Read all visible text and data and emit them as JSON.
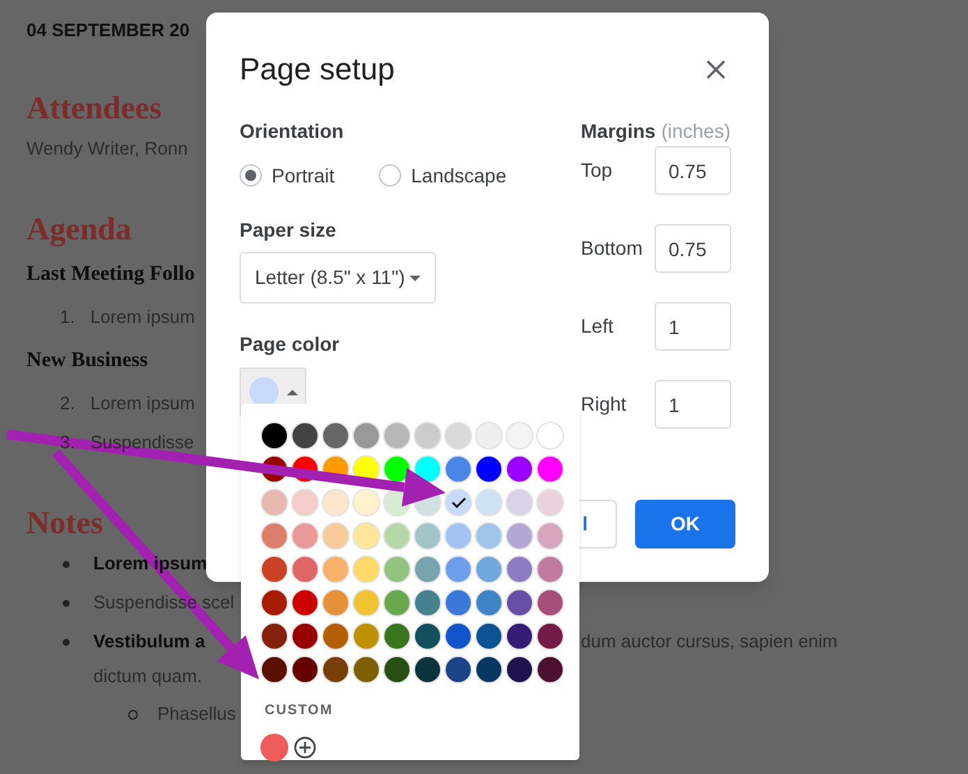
{
  "document": {
    "blocks": [
      {
        "kind": "date",
        "text": "04 SEPTEMBER 20"
      },
      {
        "kind": "heading",
        "text": "Attendees"
      },
      {
        "kind": "para",
        "text": "Wendy Writer, Ronn"
      },
      {
        "kind": "heading",
        "text": "Agenda"
      },
      {
        "kind": "subheading",
        "text": "Last Meeting Follo"
      },
      {
        "kind": "numbered",
        "number": "1.",
        "text": "Lorem ipsum"
      },
      {
        "kind": "subheading",
        "text": "New Business"
      },
      {
        "kind": "numbered",
        "number": "2.",
        "text": "Lorem ipsum"
      },
      {
        "kind": "numbered",
        "number": "3.",
        "text": "Suspendisse"
      },
      {
        "kind": "heading",
        "text": "Notes"
      },
      {
        "kind": "bullet",
        "bold": true,
        "text": "Lorem ipsum"
      },
      {
        "kind": "bullet",
        "bold": false,
        "text": "Suspendisse scel"
      },
      {
        "kind": "bullet_split",
        "bold": true,
        "text": "Vestibulum a",
        "tail": "dum auctor cursus, sapien enim"
      },
      {
        "kind": "continuation",
        "text": "dictum quam."
      },
      {
        "kind": "circle",
        "text": "Phasellus"
      }
    ]
  },
  "dialog": {
    "title": "Page setup",
    "orientation": {
      "label": "Orientation",
      "options": [
        {
          "label": "Portrait",
          "selected": true
        },
        {
          "label": "Landscape",
          "selected": false
        }
      ]
    },
    "paper_size": {
      "label": "Paper size",
      "value": "Letter (8.5\" x 11\")"
    },
    "page_color": {
      "label": "Page color",
      "color": "#c9daf8"
    },
    "margins": {
      "label": "Margins",
      "unit": "(inches)",
      "fields": [
        {
          "label": "Top",
          "value": "0.75"
        },
        {
          "label": "Bottom",
          "value": "0.75"
        },
        {
          "label": "Left",
          "value": "1"
        },
        {
          "label": "Right",
          "value": "1"
        }
      ]
    },
    "cancel_button": {
      "label": "l"
    },
    "ok_button": {
      "label": "OK"
    }
  },
  "palette": {
    "swatch_rows": [
      [
        {
          "color": "#000000",
          "selected": false
        },
        {
          "color": "#434343",
          "selected": false
        },
        {
          "color": "#666666",
          "selected": false
        },
        {
          "color": "#999999",
          "selected": false
        },
        {
          "color": "#b7b7b7",
          "selected": false
        },
        {
          "color": "#cccccc",
          "selected": false
        },
        {
          "color": "#d9d9d9",
          "selected": false
        },
        {
          "color": "#efefef",
          "selected": false
        },
        {
          "color": "#f3f3f3",
          "selected": false
        },
        {
          "color": "#ffffff",
          "selected": false
        }
      ],
      [
        {
          "color": "#980000",
          "selected": false
        },
        {
          "color": "#ff0000",
          "selected": false
        },
        {
          "color": "#ff9900",
          "selected": false
        },
        {
          "color": "#ffff00",
          "selected": false
        },
        {
          "color": "#00ff00",
          "selected": false
        },
        {
          "color": "#00ffff",
          "selected": false
        },
        {
          "color": "#4a86e8",
          "selected": false
        },
        {
          "color": "#0000ff",
          "selected": false
        },
        {
          "color": "#9900ff",
          "selected": false
        },
        {
          "color": "#ff00ff",
          "selected": false
        }
      ],
      [
        {
          "color": "#e6b8af",
          "selected": false
        },
        {
          "color": "#f4cccc",
          "selected": false
        },
        {
          "color": "#fce5cd",
          "selected": false
        },
        {
          "color": "#fff2cc",
          "selected": false
        },
        {
          "color": "#d9ead3",
          "selected": false
        },
        {
          "color": "#d0e0e3",
          "selected": false
        },
        {
          "color": "#c9daf8",
          "selected": true
        },
        {
          "color": "#cfe2f3",
          "selected": false
        },
        {
          "color": "#d9d2e9",
          "selected": false
        },
        {
          "color": "#ead1dc",
          "selected": false
        }
      ],
      [
        {
          "color": "#dd7e6b",
          "selected": false
        },
        {
          "color": "#ea9999",
          "selected": false
        },
        {
          "color": "#f9cb9c",
          "selected": false
        },
        {
          "color": "#ffe599",
          "selected": false
        },
        {
          "color": "#b6d7a8",
          "selected": false
        },
        {
          "color": "#a2c4c9",
          "selected": false
        },
        {
          "color": "#a4c2f4",
          "selected": false
        },
        {
          "color": "#9fc5e8",
          "selected": false
        },
        {
          "color": "#b4a7d6",
          "selected": false
        },
        {
          "color": "#d5a6bd",
          "selected": false
        }
      ],
      [
        {
          "color": "#cc4125",
          "selected": false
        },
        {
          "color": "#e06666",
          "selected": false
        },
        {
          "color": "#f6b26b",
          "selected": false
        },
        {
          "color": "#ffd966",
          "selected": false
        },
        {
          "color": "#93c47d",
          "selected": false
        },
        {
          "color": "#76a5af",
          "selected": false
        },
        {
          "color": "#6d9eeb",
          "selected": false
        },
        {
          "color": "#6fa8dc",
          "selected": false
        },
        {
          "color": "#8e7cc3",
          "selected": false
        },
        {
          "color": "#c27ba0",
          "selected": false
        }
      ],
      [
        {
          "color": "#a61c00",
          "selected": false
        },
        {
          "color": "#cc0000",
          "selected": false
        },
        {
          "color": "#e69138",
          "selected": false
        },
        {
          "color": "#f1c232",
          "selected": false
        },
        {
          "color": "#6aa84f",
          "selected": false
        },
        {
          "color": "#45818e",
          "selected": false
        },
        {
          "color": "#3c78d8",
          "selected": false
        },
        {
          "color": "#3d85c6",
          "selected": false
        },
        {
          "color": "#674ea7",
          "selected": false
        },
        {
          "color": "#a64d79",
          "selected": false
        }
      ],
      [
        {
          "color": "#85200c",
          "selected": false
        },
        {
          "color": "#990000",
          "selected": false
        },
        {
          "color": "#b45f06",
          "selected": false
        },
        {
          "color": "#bf9000",
          "selected": false
        },
        {
          "color": "#38761d",
          "selected": false
        },
        {
          "color": "#134f5c",
          "selected": false
        },
        {
          "color": "#1155cc",
          "selected": false
        },
        {
          "color": "#0b5394",
          "selected": false
        },
        {
          "color": "#351c75",
          "selected": false
        },
        {
          "color": "#741b47",
          "selected": false
        }
      ],
      [
        {
          "color": "#5b0f00",
          "selected": false
        },
        {
          "color": "#660000",
          "selected": false
        },
        {
          "color": "#783f04",
          "selected": false
        },
        {
          "color": "#7f6000",
          "selected": false
        },
        {
          "color": "#274e13",
          "selected": false
        },
        {
          "color": "#0c343d",
          "selected": false
        },
        {
          "color": "#1c4587",
          "selected": false
        },
        {
          "color": "#073763",
          "selected": false
        },
        {
          "color": "#20124d",
          "selected": false
        },
        {
          "color": "#4c1130",
          "selected": false
        }
      ]
    ],
    "custom_label": "CUSTOM",
    "custom_colors": [
      {
        "color": "#f05c5c"
      }
    ]
  }
}
